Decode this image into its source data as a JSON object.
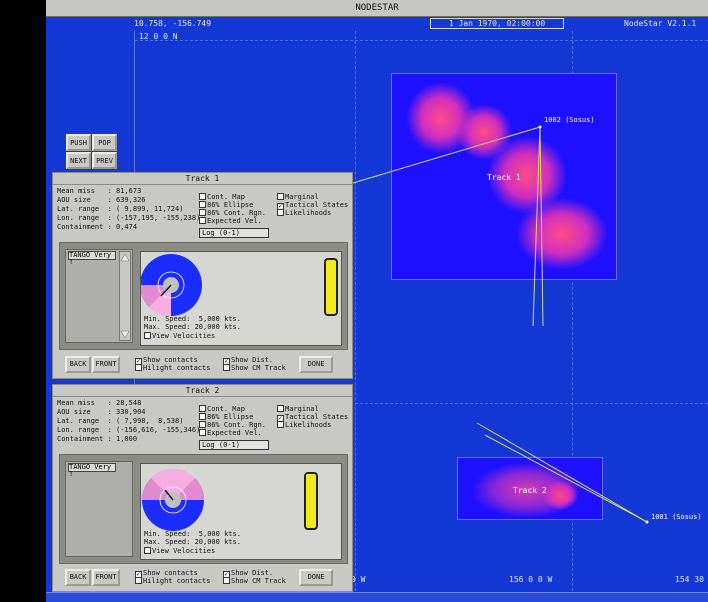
{
  "app": {
    "title": "NODESTAR",
    "coords": "10.758, -156.749",
    "date": "1 Jan 1970, 02:00:00",
    "version": "NodeStar V2.1.1"
  },
  "map": {
    "lat_label": "12 0 0 N",
    "bottom_labels": [
      "0 W",
      "156 0 0 W",
      "154 30"
    ],
    "tracks": [
      "Track 1",
      "Track 2"
    ],
    "sensors": [
      "1002 (Sosus)",
      "1001 (Sosus)"
    ]
  },
  "nav_buttons": [
    "PUSH",
    "POP",
    "NEXT",
    "PREV"
  ],
  "panels": [
    {
      "title": "Track 1",
      "stats": [
        "Mean miss   : 81,673",
        "AOU size    : 639,326",
        "Lat. range  : ( 9,899, 11,724)",
        "Lon. range  : (-157,195, -155,238)",
        "Containment : 0,474"
      ],
      "options_left": [
        "Cont. Map",
        "86% Ellipse",
        "86% Cont. Rgn.",
        "Expected Vel."
      ],
      "options_right": [
        "Marginal",
        "Tactical States",
        "Likelihoods"
      ],
      "log": "Log    (0-1)",
      "list_header": "TANGO Very !",
      "velocity": [
        "Min. Speed:  5,000 kts.",
        "Max. Speed: 20,000 kts."
      ],
      "view_velocities": "View Velocities",
      "buttons": [
        "BACK",
        "FRONT",
        "DONE"
      ],
      "show": [
        "Show contacts",
        "Hilight contacts"
      ],
      "show2": [
        "Show Dist.",
        "Show CM Track"
      ]
    },
    {
      "title": "Track 2",
      "stats": [
        "Mean miss   : 28,548",
        "AOU size    : 330,904",
        "Lat. range  : ( 7,998,  8,538)",
        "Lon. range  : (-156,616, -155,346)",
        "Containment : 1,000"
      ],
      "options_left": [
        "Cont. Map",
        "86% Ellipse",
        "86% Cont. Rgn.",
        "Expected Vel."
      ],
      "options_right": [
        "Marginal",
        "Tactical States",
        "Likelihoods"
      ],
      "log": "Log    (0-1)",
      "list_header": "TANGO Very !",
      "velocity": [
        "Min. Speed:  5,000 kts.",
        "Max. Speed: 20,000 kts."
      ],
      "view_velocities": "View Velocities",
      "buttons": [
        "BACK",
        "FRONT",
        "DONE"
      ],
      "show": [
        "Show contacts",
        "Hilight contacts"
      ],
      "show2": [
        "Show Dist.",
        "Show CM Track"
      ]
    }
  ],
  "colors": {
    "map_bg": "#1338d6",
    "heat_bg": "#1c10ff",
    "heat_hot": "#ff3f86",
    "panel": "#c8c9c4",
    "yellow": "#f3ea1e"
  }
}
